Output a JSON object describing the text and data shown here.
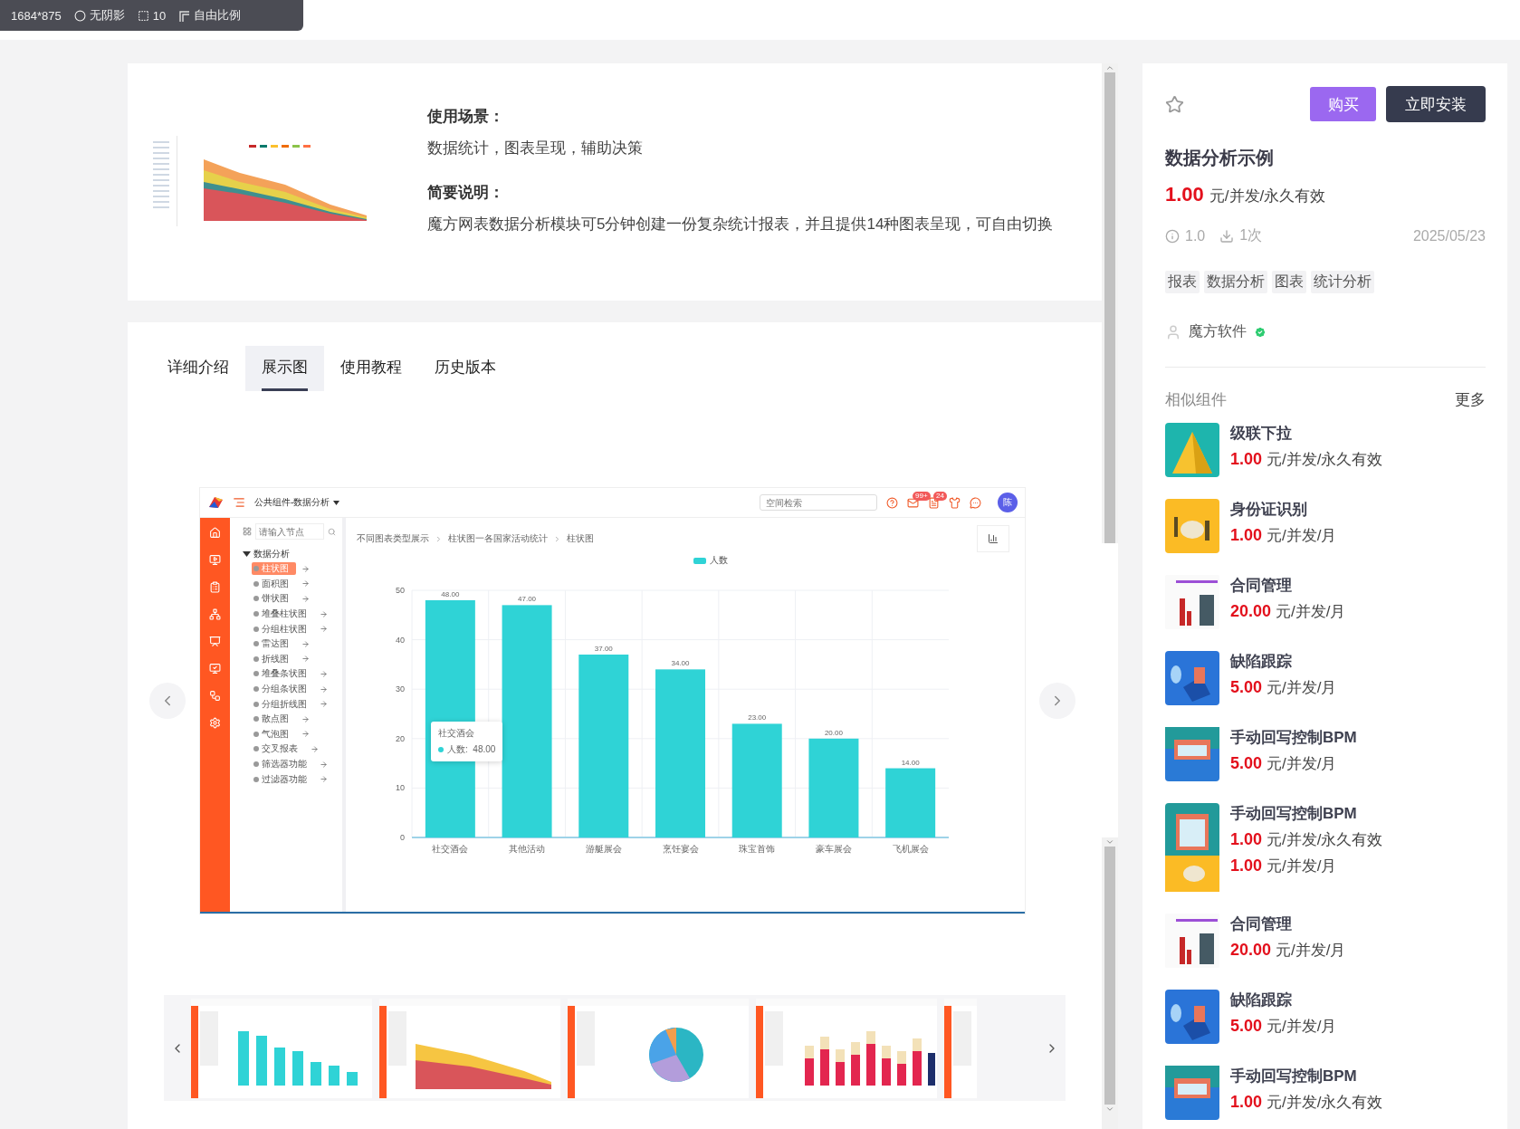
{
  "capture_toolbar": {
    "size": "1684*875",
    "shadow": "无阴影",
    "radius": "10",
    "ratio": "自由比例"
  },
  "summary": {
    "sections": [
      {
        "heading": "使用场景：",
        "body": "数据统计，图表呈现，辅助决策"
      },
      {
        "heading": "简要说明：",
        "body": "魔方网表数据分析模块可5分钟创建一份复杂统计报表，并且提供14种图表呈现，可自由切换"
      }
    ]
  },
  "tabs": [
    {
      "label": "详细介绍",
      "selected": false
    },
    {
      "label": "展示图",
      "selected": true
    },
    {
      "label": "使用教程",
      "selected": false
    },
    {
      "label": "历史版本",
      "selected": false
    }
  ],
  "showcase": {
    "app": {
      "title": "公共组件-数据分析",
      "search_placeholder": "空间检索",
      "header_icons": [
        {
          "kind": "help"
        },
        {
          "kind": "mail",
          "badge": "99+"
        },
        {
          "kind": "list",
          "badge": "24"
        },
        {
          "kind": "shirt"
        },
        {
          "kind": "more"
        }
      ],
      "avatar": "陈",
      "tree_search_placeholder": "请输入节点",
      "tree": {
        "label": "数据分析",
        "expanded": true,
        "children": [
          {
            "label": "柱状图",
            "selected": true
          },
          {
            "label": "面积图",
            "selected": false
          },
          {
            "label": "饼状图",
            "selected": false
          },
          {
            "label": "堆叠柱状图",
            "selected": false
          },
          {
            "label": "分组柱状图",
            "selected": false
          },
          {
            "label": "雷达图",
            "selected": false
          },
          {
            "label": "折线图",
            "selected": false
          },
          {
            "label": "堆叠条状图",
            "selected": false
          },
          {
            "label": "分组条状图",
            "selected": false
          },
          {
            "label": "分组折线图",
            "selected": false
          },
          {
            "label": "散点图",
            "selected": false
          },
          {
            "label": "气泡图",
            "selected": false
          },
          {
            "label": "交叉报表",
            "selected": false
          },
          {
            "label": "筛选器功能",
            "selected": false
          },
          {
            "label": "过滤器功能",
            "selected": false
          }
        ]
      },
      "breadcrumb": [
        "不同图表类型展示",
        "柱状图一各国家活动统计",
        "柱状图"
      ],
      "chart_data": {
        "type": "bar",
        "categories": [
          "社交酒会",
          "其他活动",
          "游艇展会",
          "烹饪宴会",
          "珠宝首饰",
          "豪车展会",
          "飞机展会"
        ],
        "series": [
          {
            "name": "人数",
            "color": "#2fd3d6",
            "values": [
              48,
              47,
              37,
              34,
              23,
              20,
              14
            ]
          }
        ],
        "ylim": [
          0,
          50
        ],
        "yticks": [
          0,
          10,
          20,
          30,
          40,
          50
        ],
        "grid": true,
        "value_labels": [
          "48.00",
          "47.00",
          "37.00",
          "34.00",
          "23.00",
          "20.00",
          "14.00"
        ]
      },
      "tooltip": {
        "title": "社交酒会",
        "label": "人数:",
        "value": "48.00"
      }
    },
    "thumbnails": [
      {
        "kind": "bar"
      },
      {
        "kind": "area"
      },
      {
        "kind": "pie"
      },
      {
        "kind": "stacked"
      },
      {
        "kind": "partial"
      }
    ]
  },
  "product": {
    "favorited": false,
    "buy": "购买",
    "install": "立即安装",
    "title": "数据分析示例",
    "price": {
      "amount": "1.00",
      "unit": "元/并发/永久有效"
    },
    "version": "1.0",
    "downloads": "1次",
    "date": "2025/05/23",
    "tags": [
      "报表",
      "数据分析",
      "图表",
      "统计分析"
    ],
    "author": "魔方软件",
    "verified": true
  },
  "similar": {
    "title": "相似组件",
    "more": "更多",
    "items": [
      {
        "name": "级联下拉",
        "prices": [
          {
            "amount": "1.00",
            "unit": "元/并发/永久有效"
          }
        ]
      },
      {
        "name": "身份证识别",
        "prices": [
          {
            "amount": "1.00",
            "unit": "元/并发/月"
          }
        ]
      },
      {
        "name": "合同管理",
        "prices": [
          {
            "amount": "20.00",
            "unit": "元/并发/月"
          }
        ]
      },
      {
        "name": "缺陷跟踪",
        "prices": [
          {
            "amount": "5.00",
            "unit": "元/并发/月"
          }
        ]
      },
      {
        "name": "手动回写控制BPM",
        "prices": [
          {
            "amount": "5.00",
            "unit": "元/并发/月"
          }
        ]
      },
      {
        "name": "手动回写控制BPM",
        "prices": [
          {
            "amount": "1.00",
            "unit": "元/并发/永久有效"
          },
          {
            "amount": "1.00",
            "unit": "元/并发/月"
          }
        ]
      },
      {
        "name": "合同管理",
        "prices": [
          {
            "amount": "20.00",
            "unit": "元/并发/月"
          }
        ]
      },
      {
        "name": "缺陷跟踪",
        "prices": [
          {
            "amount": "5.00",
            "unit": "元/并发/月"
          }
        ]
      },
      {
        "name": "手动回写控制BPM",
        "prices": [
          {
            "amount": "1.00",
            "unit": "元/并发/永久有效"
          }
        ]
      }
    ]
  }
}
